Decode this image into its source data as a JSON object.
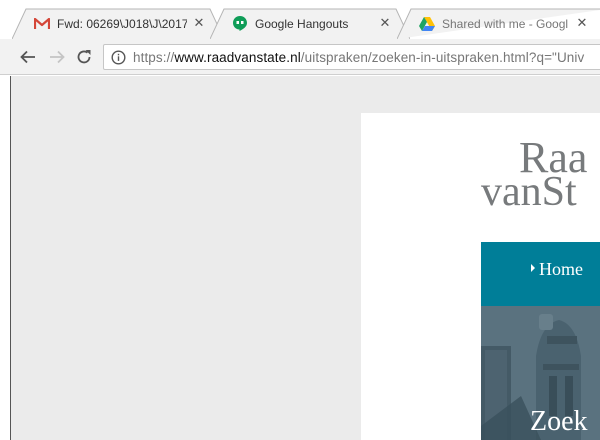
{
  "browser": {
    "tabs": [
      {
        "title": "Fwd: 06269\\J018\\J\\2017",
        "icon": "gmail-icon"
      },
      {
        "title": "Google Hangouts",
        "icon": "hangouts-icon"
      },
      {
        "title": "Shared with me - Google",
        "icon": "google-drive-icon"
      }
    ],
    "url": {
      "scheme": "https://",
      "host": "www.raadvanstate.nl",
      "path": "/uitspraken/zoeken-in-uitspraken.html?q=\"Univ"
    },
    "close_glyph": "✕"
  },
  "site": {
    "logo_line1": "Raa",
    "logo_line2": "vanSt",
    "nav_home": "Home",
    "hero_title": "Zoek",
    "colors": {
      "teal": "#007e98",
      "logo_gray": "#777a7c"
    }
  }
}
